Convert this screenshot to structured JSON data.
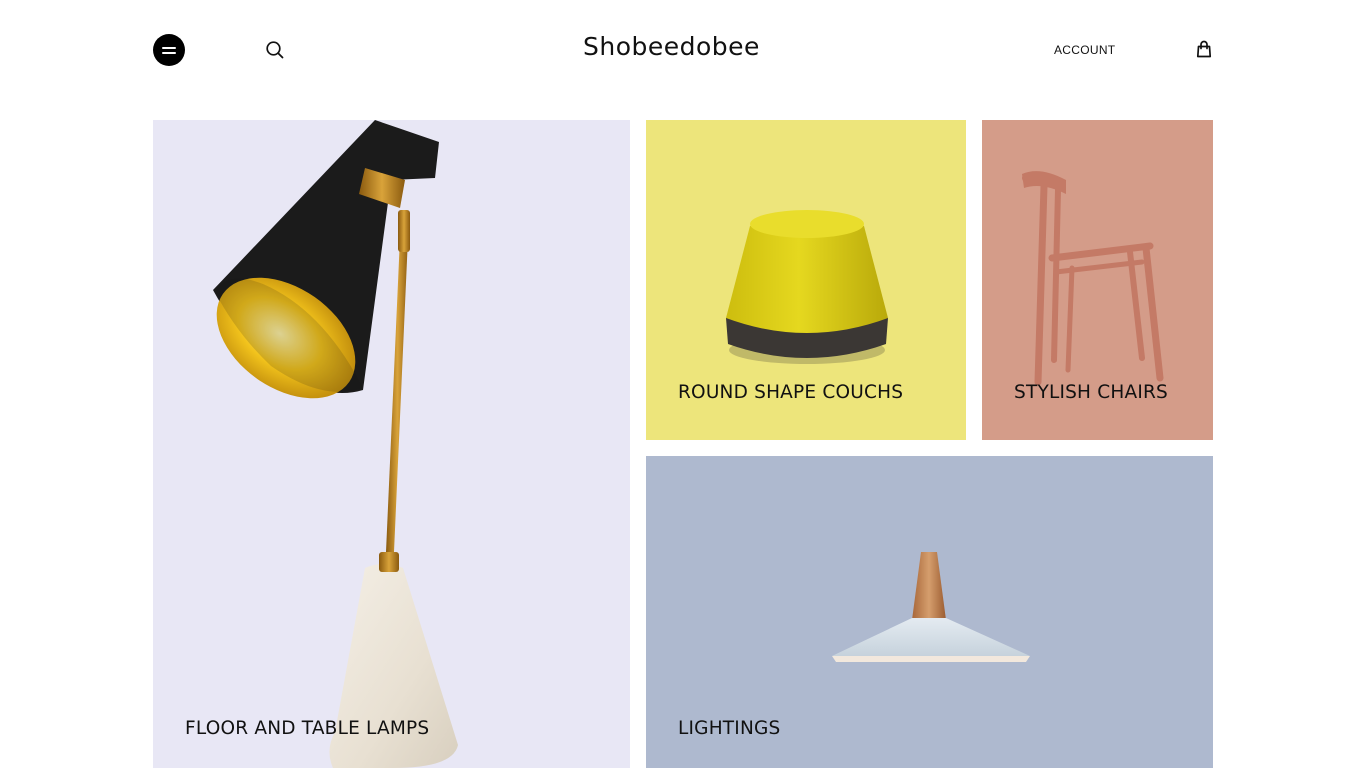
{
  "header": {
    "menu_icon": "menu-icon",
    "search_icon": "search-icon",
    "logo": "Shobeedobee",
    "account_label": "ACCOUNT",
    "cart_icon": "shopping-bag-icon"
  },
  "categories": [
    {
      "label": "FLOOR AND TABLE LAMPS",
      "image": "table-lamp-image",
      "color": "#e8e7f5"
    },
    {
      "label": "ROUND SHAPE COUCHS",
      "image": "round-pouf-image",
      "color": "#ede57b"
    },
    {
      "label": "STYLISH CHAIRS",
      "image": "wooden-chair-image",
      "color": "#d49c89"
    },
    {
      "label": "LIGHTINGS",
      "image": "pendant-light-image",
      "color": "#aeb9cf"
    }
  ]
}
